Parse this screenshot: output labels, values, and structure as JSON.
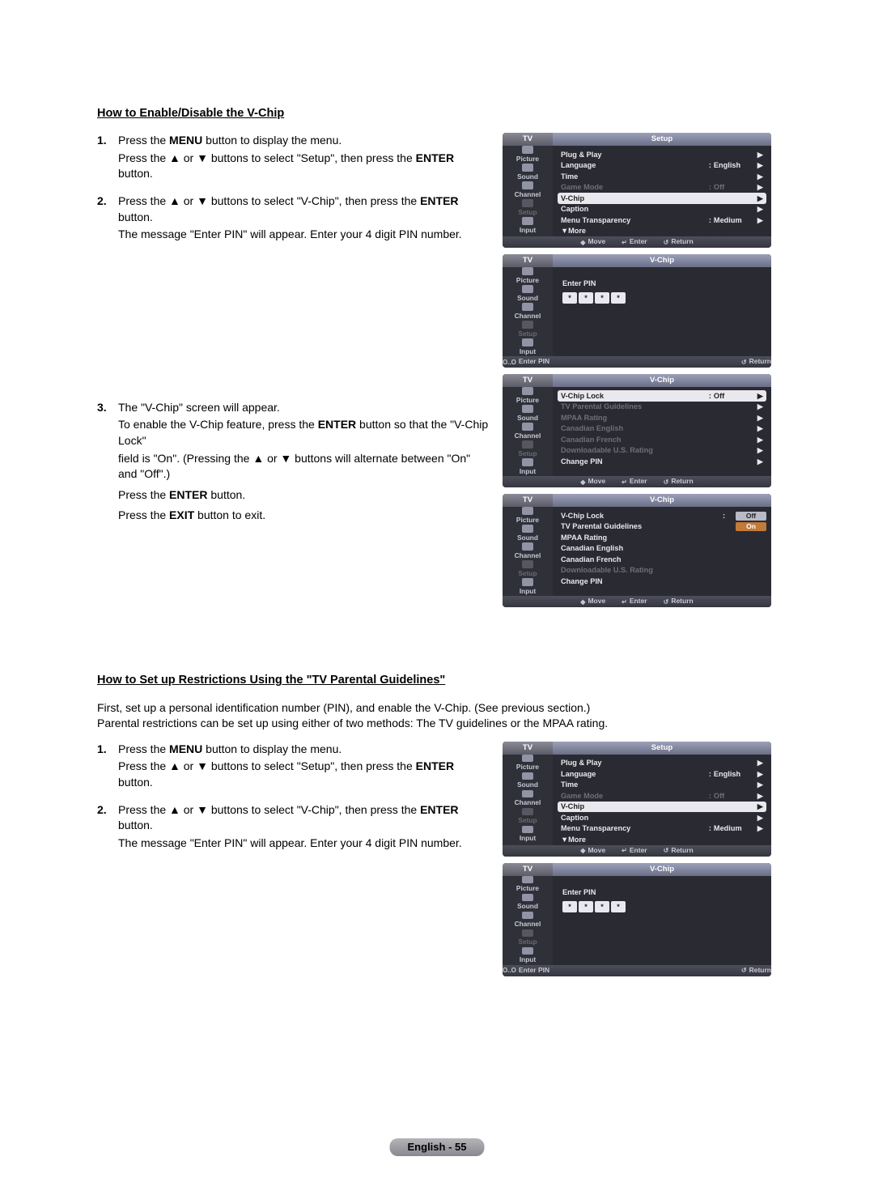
{
  "section1": {
    "title": "How to Enable/Disable the V-Chip",
    "step1": {
      "num": "1.",
      "line1_a": "Press the ",
      "line1_b": "MENU",
      "line1_c": " button to display the menu.",
      "line2_a": "Press the ▲ or ▼ buttons to select \"Setup\", then press the ",
      "line2_b": "ENTER",
      "line2_c": " button."
    },
    "step2": {
      "num": "2.",
      "line1_a": "Press the ▲ or ▼ buttons to select \"V-Chip\", then press the ",
      "line1_b": "ENTER",
      "line1_c": " button.",
      "line2": "The message \"Enter PIN\" will appear. Enter your 4 digit PIN number."
    },
    "step3": {
      "num": "3.",
      "line1": "The \"V-Chip\" screen will appear.",
      "line2_a": "To enable the V-Chip feature, press the ",
      "line2_b": "ENTER",
      "line2_c": " button so that the \"V-Chip Lock\"",
      "line3": "field is \"On\". (Pressing the ▲ or ▼ buttons will alternate between \"On\" and \"Off\".)",
      "line4_a": "Press the ",
      "line4_b": "ENTER",
      "line4_c": " button.",
      "line5_a": "Press the ",
      "line5_b": "EXIT",
      "line5_c": " button to exit."
    }
  },
  "section2": {
    "title": "How to Set up Restrictions Using the \"TV Parental Guidelines\"",
    "intro1": "First, set up a personal identification number (PIN), and enable the V-Chip. (See previous section.)",
    "intro2": "Parental restrictions can be set up using either of two methods: The TV guidelines or the MPAA rating.",
    "step1": {
      "num": "1.",
      "line1_a": "Press the ",
      "line1_b": "MENU",
      "line1_c": " button to display the menu.",
      "line2_a": "Press the ▲ or ▼ buttons to select \"Setup\", then press the ",
      "line2_b": "ENTER",
      "line2_c": " button."
    },
    "step2": {
      "num": "2.",
      "line1_a": "Press the ▲ or ▼ buttons to select \"V-Chip\", then press the ",
      "line1_b": "ENTER",
      "line1_c": " button.",
      "line2": "The message \"Enter PIN\" will appear. Enter your 4 digit PIN number."
    }
  },
  "osd_common": {
    "tv": "TV",
    "sidebar": {
      "picture": "Picture",
      "sound": "Sound",
      "channel": "Channel",
      "setup": "Setup",
      "input": "Input"
    },
    "footer": {
      "move_sym": "◆",
      "move": "Move",
      "enter_sym": "↵",
      "enter": "Enter",
      "return_sym": "↺",
      "return": "Return",
      "enterpin_sym": "O..O",
      "enterpin": "Enter PIN"
    },
    "arrow": "▶",
    "colon": ":"
  },
  "osd_setup": {
    "title": "Setup",
    "rows": {
      "plug": "Plug & Play",
      "lang": "Language",
      "lang_v": "English",
      "time": "Time",
      "game": "Game Mode",
      "game_v": "Off",
      "vchip": "V-Chip",
      "caption": "Caption",
      "trans": "Menu Transparency",
      "trans_v": "Medium",
      "more": "▼More"
    }
  },
  "osd_vchip_pin": {
    "title": "V-Chip",
    "enterpin": "Enter PIN",
    "dot": "*"
  },
  "osd_vchip_settings": {
    "title": "V-Chip",
    "rows": {
      "lock": "V-Chip Lock",
      "lock_v": "Off",
      "tvpg": "TV Parental Guidelines",
      "mpaa": "MPAA Rating",
      "can_en": "Canadian English",
      "can_fr": "Canadian French",
      "dl": "Downloadable U.S. Rating",
      "chpin": "Change PIN"
    }
  },
  "osd_vchip_toggle": {
    "title": "V-Chip",
    "off": "Off",
    "on": "On"
  },
  "page_footer": "English - 55"
}
